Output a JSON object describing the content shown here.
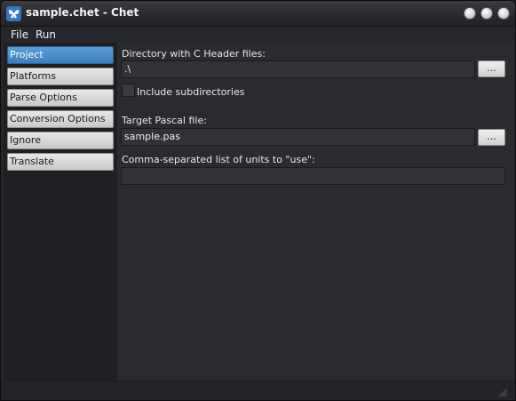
{
  "window": {
    "title": "sample.chet - Chet"
  },
  "menu": {
    "items": [
      "File",
      "Run"
    ]
  },
  "sidebar": {
    "items": [
      {
        "label": "Project",
        "active": true
      },
      {
        "label": "Platforms",
        "active": false
      },
      {
        "label": "Parse Options",
        "active": false
      },
      {
        "label": "Conversion Options",
        "active": false
      },
      {
        "label": "Ignore",
        "active": false
      },
      {
        "label": "Translate",
        "active": false
      }
    ]
  },
  "project": {
    "header_dir_label": "Directory with C Header files:",
    "header_dir_value": ".\\",
    "browse_label": "...",
    "include_subdirs_label": "Include subdirectories",
    "include_subdirs_checked": false,
    "target_label": "Target Pascal file:",
    "target_value": "sample.pas",
    "units_label": "Comma-separated list of units to \"use\":",
    "units_value": ""
  },
  "colors": {
    "accent": "#3b7fbf",
    "background": "#26272b"
  }
}
